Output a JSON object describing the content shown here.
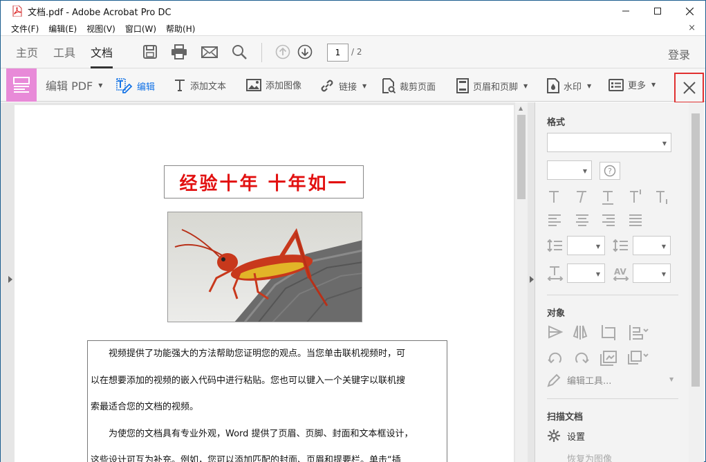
{
  "window": {
    "title": "文档.pdf - Adobe Acrobat Pro DC",
    "minimize": "—",
    "maximize": "☐",
    "close": "✕"
  },
  "menu": {
    "items": [
      "文件(F)",
      "编辑(E)",
      "视图(V)",
      "窗口(W)",
      "帮助(H)"
    ],
    "close_doc": "×"
  },
  "nav": {
    "tabs": [
      "主页",
      "工具",
      "文档"
    ],
    "active_tab": "文档",
    "page_current": "1",
    "page_total": "/ 2",
    "login": "登录"
  },
  "edit_toolbar": {
    "edit_pdf": "编辑 PDF",
    "edit": "编辑",
    "add_text": "添加文本",
    "add_image": "添加图像",
    "link": "链接",
    "crop": "裁剪页面",
    "header_footer": "页眉和页脚",
    "watermark": "水印",
    "more": "更多"
  },
  "document": {
    "headline": "经验十年 十年如一",
    "paragraphs": [
      "　　视频提供了功能强大的方法帮助您证明您的观点。当您单击联机视频时，可",
      "以在想要添加的视频的嵌入代码中进行粘贴。您也可以键入一个关键字以联机搜",
      "索最适合您的文档的视频。",
      "　　为使您的文档具有专业外观，Word 提供了页眉、页脚、封面和文本框设计，",
      "这些设计可互为补充。例如，您可以添加匹配的封面、页眉和提要栏。单击“插"
    ]
  },
  "right_panel": {
    "format_title": "格式",
    "object_title": "对象",
    "edit_tool": "编辑工具...",
    "scanned_title": "扫描文档",
    "settings": "设置",
    "restore_image": "恢复为图像"
  },
  "colors": {
    "accent": "#1473e6",
    "edit_tool_bg": "#e88ad8",
    "headline": "#e21010",
    "highlight_box": "#e03030"
  }
}
